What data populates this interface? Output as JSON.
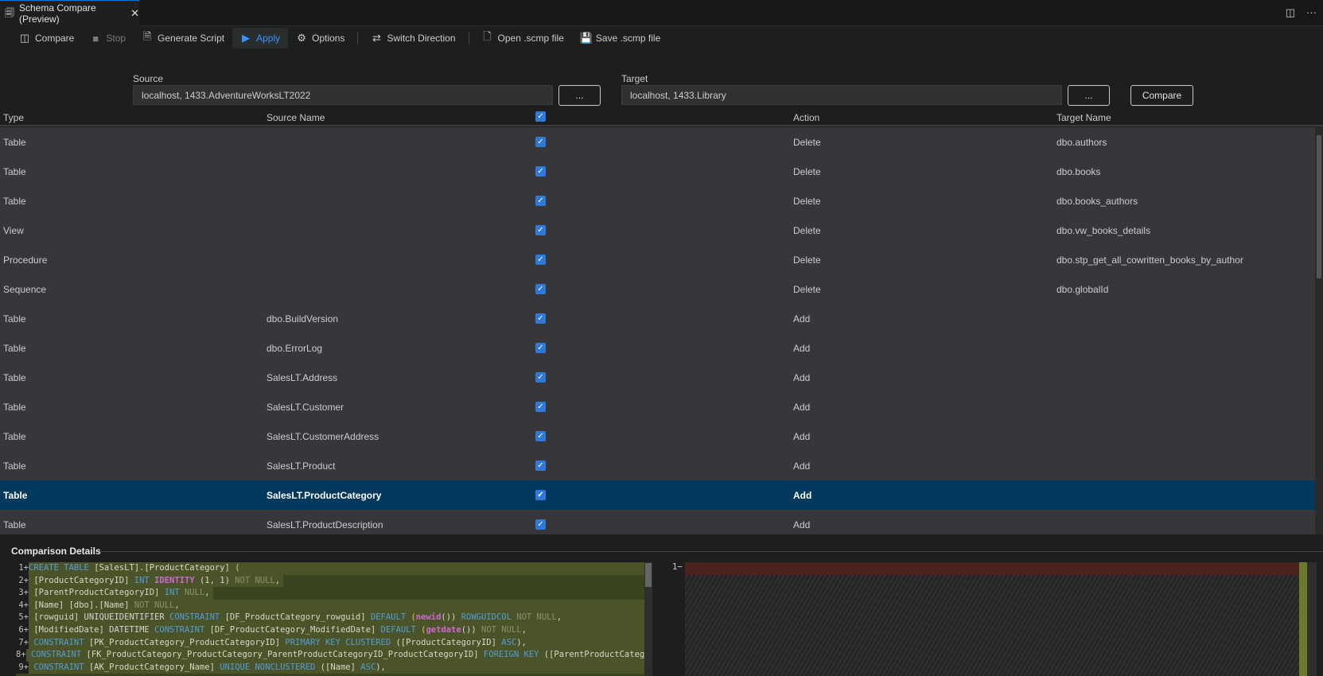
{
  "tab": {
    "title": "Schema Compare (Preview)",
    "close": "✕",
    "split_icon": "split-editor-icon",
    "more": "···"
  },
  "toolbar": {
    "items": [
      {
        "label": "Compare",
        "icon": "compare-icon",
        "glyph": "◫",
        "disabled": false
      },
      {
        "label": "Stop",
        "icon": "stop-icon",
        "glyph": "■",
        "disabled": true
      },
      {
        "label": "Generate Script",
        "icon": "script-icon",
        "glyph": "🗎",
        "disabled": false
      },
      {
        "label": "Apply",
        "icon": "play-icon",
        "glyph": "▶",
        "disabled": false,
        "hover": true
      },
      {
        "label": "Options",
        "icon": "gear-icon",
        "glyph": "⚙",
        "disabled": false
      },
      {
        "label": "Switch Direction",
        "icon": "switch-icon",
        "glyph": "⇄",
        "disabled": false
      },
      {
        "label": "Open .scmp file",
        "icon": "open-file-icon",
        "glyph": "🗋",
        "disabled": false
      },
      {
        "label": "Save .scmp file",
        "icon": "save-icon",
        "glyph": "💾",
        "disabled": false
      }
    ]
  },
  "source": {
    "label": "Source",
    "value": "localhost, 1433.AdventureWorksLT2022",
    "browse": "..."
  },
  "target": {
    "label": "Target",
    "value": "localhost, 1433.Library",
    "browse": "...",
    "compare": "Compare"
  },
  "grid": {
    "headers": {
      "type": "Type",
      "source": "Source Name",
      "action": "Action",
      "target": "Target Name"
    },
    "selected_index": 12,
    "rows": [
      {
        "type": "Table",
        "source": "",
        "checked": true,
        "action": "Delete",
        "target": "dbo.authors"
      },
      {
        "type": "Table",
        "source": "",
        "checked": true,
        "action": "Delete",
        "target": "dbo.books"
      },
      {
        "type": "Table",
        "source": "",
        "checked": true,
        "action": "Delete",
        "target": "dbo.books_authors"
      },
      {
        "type": "View",
        "source": "",
        "checked": true,
        "action": "Delete",
        "target": "dbo.vw_books_details"
      },
      {
        "type": "Procedure",
        "source": "",
        "checked": true,
        "action": "Delete",
        "target": "dbo.stp_get_all_cowritten_books_by_author"
      },
      {
        "type": "Sequence",
        "source": "",
        "checked": true,
        "action": "Delete",
        "target": "dbo.globalId"
      },
      {
        "type": "Table",
        "source": "dbo.BuildVersion",
        "checked": true,
        "action": "Add",
        "target": ""
      },
      {
        "type": "Table",
        "source": "dbo.ErrorLog",
        "checked": true,
        "action": "Add",
        "target": ""
      },
      {
        "type": "Table",
        "source": "SalesLT.Address",
        "checked": true,
        "action": "Add",
        "target": ""
      },
      {
        "type": "Table",
        "source": "SalesLT.Customer",
        "checked": true,
        "action": "Add",
        "target": ""
      },
      {
        "type": "Table",
        "source": "SalesLT.CustomerAddress",
        "checked": true,
        "action": "Add",
        "target": ""
      },
      {
        "type": "Table",
        "source": "SalesLT.Product",
        "checked": true,
        "action": "Add",
        "target": ""
      },
      {
        "type": "Table",
        "source": "SalesLT.ProductCategory",
        "checked": true,
        "action": "Add",
        "target": ""
      },
      {
        "type": "Table",
        "source": "SalesLT.ProductDescription",
        "checked": true,
        "action": "Add",
        "target": ""
      }
    ]
  },
  "details": {
    "title": "Comparison Details",
    "right_line": "1−",
    "left_lines": [
      {
        "n": "1+",
        "segs": [
          {
            "t": "CREATE TABLE ",
            "k": "kw"
          },
          {
            "t": "[SalesLT].[ProductCategory]",
            "k": "id"
          },
          {
            "t": " (",
            "k": "p"
          }
        ]
      },
      {
        "n": "2+",
        "segs": [
          {
            "t": " [ProductCategoryID] ",
            "k": "id"
          },
          {
            "t": "INT ",
            "k": "kw"
          },
          {
            "t": "IDENTITY",
            "k": "fn"
          },
          {
            "t": " (1, 1) ",
            "k": "t"
          },
          {
            "t": "NOT NULL",
            "k": "gray"
          },
          {
            "t": ",",
            "k": "t"
          }
        ]
      },
      {
        "n": "3+",
        "segs": [
          {
            "t": " [ParentProductCategoryID] ",
            "k": "id"
          },
          {
            "t": "INT ",
            "k": "kw"
          },
          {
            "t": "NULL",
            "k": "gray"
          },
          {
            "t": ",",
            "k": "t"
          }
        ]
      },
      {
        "n": "4+",
        "segs": [
          {
            "t": " [Name] [dbo].[Name] ",
            "k": "id"
          },
          {
            "t": "NOT NULL",
            "k": "gray"
          },
          {
            "t": ",",
            "k": "t"
          }
        ]
      },
      {
        "n": "5+",
        "segs": [
          {
            "t": " [rowguid] ",
            "k": "id"
          },
          {
            "t": "UNIQUEIDENTIFIER ",
            "k": "t"
          },
          {
            "t": "CONSTRAINT ",
            "k": "kw"
          },
          {
            "t": "[DF_ProductCategory_rowguid] ",
            "k": "id"
          },
          {
            "t": "DEFAULT ",
            "k": "kw"
          },
          {
            "t": "(",
            "k": "p"
          },
          {
            "t": "newid",
            "k": "fn"
          },
          {
            "t": "()) ",
            "k": "t"
          },
          {
            "t": "ROWGUIDCOL ",
            "k": "kw"
          },
          {
            "t": "NOT NULL",
            "k": "gray"
          },
          {
            "t": ",",
            "k": "t"
          }
        ]
      },
      {
        "n": "6+",
        "segs": [
          {
            "t": " [ModifiedDate] ",
            "k": "id"
          },
          {
            "t": "DATETIME ",
            "k": "t"
          },
          {
            "t": "CONSTRAINT ",
            "k": "kw"
          },
          {
            "t": "[DF_ProductCategory_ModifiedDate] ",
            "k": "id"
          },
          {
            "t": "DEFAULT ",
            "k": "kw"
          },
          {
            "t": "(",
            "k": "p"
          },
          {
            "t": "getdate",
            "k": "fn"
          },
          {
            "t": "()) ",
            "k": "t"
          },
          {
            "t": "NOT NULL",
            "k": "gray"
          },
          {
            "t": ",",
            "k": "t"
          }
        ]
      },
      {
        "n": "7+",
        "segs": [
          {
            "t": " CONSTRAINT ",
            "k": "kw"
          },
          {
            "t": "[PK_ProductCategory_ProductCategoryID] ",
            "k": "id"
          },
          {
            "t": "PRIMARY KEY CLUSTERED ",
            "k": "kw"
          },
          {
            "t": "([ProductCategoryID] ",
            "k": "id"
          },
          {
            "t": "ASC",
            "k": "kw"
          },
          {
            "t": "),",
            "k": "t"
          }
        ]
      },
      {
        "n": "8+",
        "segs": [
          {
            "t": " CONSTRAINT ",
            "k": "kw"
          },
          {
            "t": "[FK_ProductCategory_ProductCategory_ParentProductCategoryID_ProductCategoryID] ",
            "k": "id"
          },
          {
            "t": "FOREIGN KEY ",
            "k": "kw"
          },
          {
            "t": "([ParentProductCatego",
            "k": "id"
          }
        ]
      },
      {
        "n": "9+",
        "segs": [
          {
            "t": " CONSTRAINT ",
            "k": "kw"
          },
          {
            "t": "[AK_ProductCategory_Name] ",
            "k": "id"
          },
          {
            "t": "UNIQUE NONCLUSTERED ",
            "k": "kw"
          },
          {
            "t": "([Name] ",
            "k": "id"
          },
          {
            "t": "ASC",
            "k": "kw"
          },
          {
            "t": "),",
            "k": "t"
          }
        ]
      }
    ]
  }
}
